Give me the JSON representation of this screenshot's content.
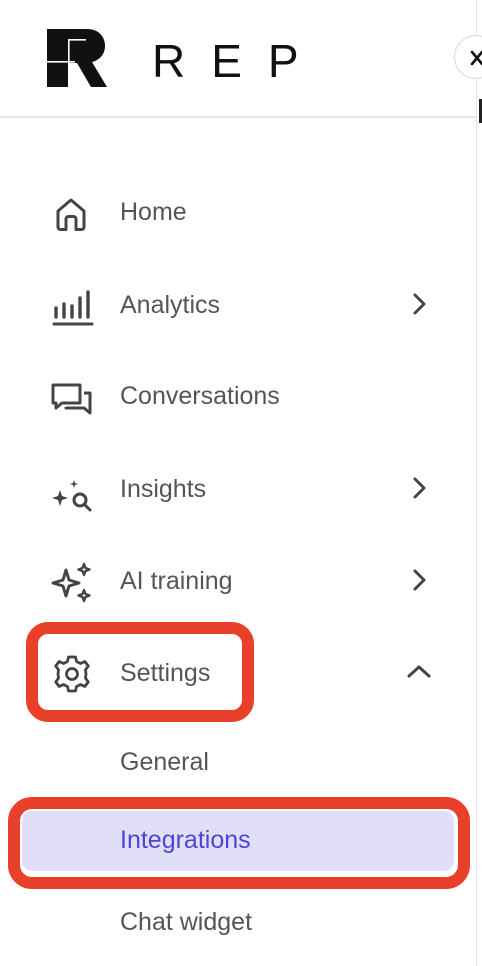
{
  "brand": {
    "logo_text": "REP"
  },
  "nav": {
    "items": [
      {
        "label": "Home",
        "icon": "home-icon",
        "has_chevron": false
      },
      {
        "label": "Analytics",
        "icon": "analytics-icon",
        "has_chevron": true
      },
      {
        "label": "Conversations",
        "icon": "conversations-icon",
        "has_chevron": false
      },
      {
        "label": "Insights",
        "icon": "insights-icon",
        "has_chevron": true
      },
      {
        "label": "AI training",
        "icon": "ai-training-icon",
        "has_chevron": true
      },
      {
        "label": "Settings",
        "icon": "gear-icon",
        "has_chevron": true,
        "expanded": true
      }
    ],
    "settings_submenu": [
      {
        "label": "General",
        "active": false
      },
      {
        "label": "Integrations",
        "active": true
      },
      {
        "label": "Chat widget",
        "active": false
      }
    ]
  },
  "colors": {
    "active_text": "#4f43d9",
    "active_bg": "#e1dff8",
    "highlight_outline": "#e8402a",
    "label_text": "#555555"
  }
}
